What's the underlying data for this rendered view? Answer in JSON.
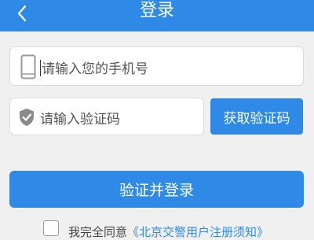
{
  "header": {
    "back_icon": "chevron-left-icon",
    "title": "登录",
    "background_color": "#2e8ae6"
  },
  "phone_input": {
    "icon": "smartphone-icon",
    "placeholder": "请输入您的手机号",
    "value": ""
  },
  "code_input": {
    "icon": "shield-check-icon",
    "placeholder": "请输入验证码",
    "value": ""
  },
  "get_code_button": {
    "label": "获取验证码"
  },
  "login_button": {
    "label": "验证并登录"
  },
  "agreement": {
    "checked": false,
    "text": "我完全同意",
    "link_text": "《北京交警用户注册须知》"
  },
  "colors": {
    "accent": "#2e8ae6",
    "page_background": "#f0f0f0",
    "input_background": "#ffffff"
  }
}
